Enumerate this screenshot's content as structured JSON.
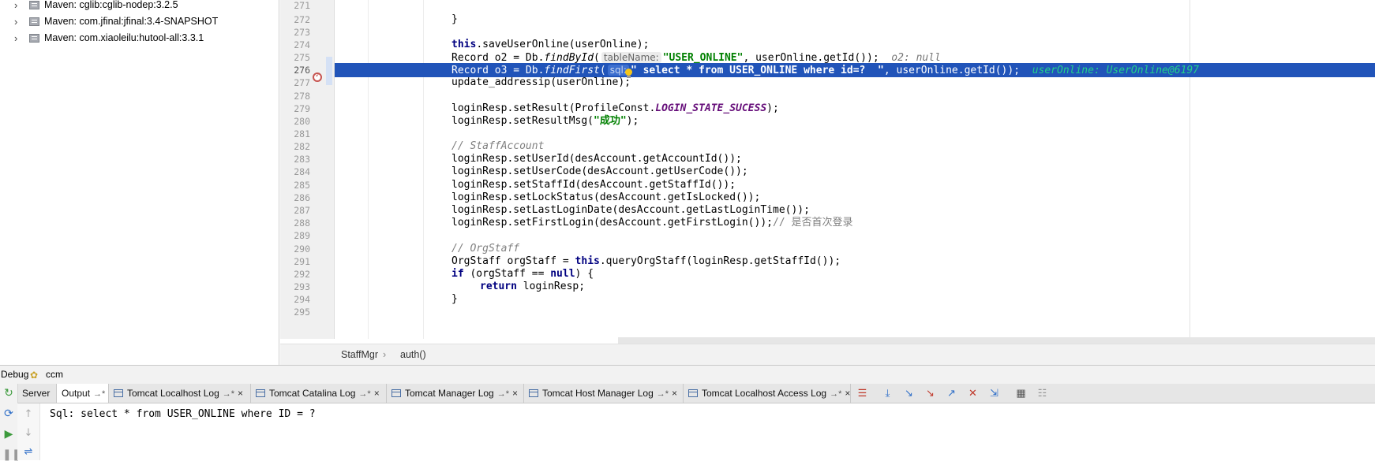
{
  "project_tree": {
    "items": [
      {
        "label": "Maven: cglib:cglib-nodep:3.2.5"
      },
      {
        "label": "Maven: com.jfinal:jfinal:3.4-SNAPSHOT"
      },
      {
        "label": "Maven: com.xiaoleilu:hutool-all:3.3.1"
      }
    ]
  },
  "editor": {
    "line_numbers": [
      "271",
      "272",
      "273",
      "274",
      "275",
      "276",
      "277",
      "278",
      "279",
      "280",
      "281",
      "282",
      "283",
      "284",
      "285",
      "286",
      "287",
      "288",
      "289",
      "290",
      "291",
      "292",
      "293",
      "294",
      "295"
    ],
    "execution_line": "276",
    "code": {
      "l272": "}",
      "l274_kw": "this",
      "l274_rest": ".saveUserOnline(userOnline);",
      "l275_a": "Record o2 = Db.",
      "l275_method": "findById",
      "l275_b": "(",
      "l275_hint": "tableName:",
      "l275_str": "\"USER_ONLINE\"",
      "l275_c": ", userOnline.getId());",
      "l275_debug": "o2: null",
      "l276_a": "Record o3 = Db.",
      "l276_method": "findFirst",
      "l276_b": "(",
      "l276_hint": "sql:",
      "l276_str": "\" select * from USER_ONLINE where id=?  \"",
      "l276_c": ", userOnline.getId());",
      "l276_debug": "userOnline: UserOnline@6197",
      "l277": "update_addressip(userOnline);",
      "l279_a": "loginResp.setResult(ProfileConst.",
      "l279_const": "LOGIN_STATE_SUCESS",
      "l279_b": ");",
      "l280_a": "loginResp.setResultMsg(",
      "l280_str": "\"成功\"",
      "l280_b": ");",
      "l282": "// StaffAccount",
      "l283": "loginResp.setUserId(desAccount.getAccountId());",
      "l284": "loginResp.setUserCode(desAccount.getUserCode());",
      "l285": "loginResp.setStaffId(desAccount.getStaffId());",
      "l286": "loginResp.setLockStatus(desAccount.getIsLocked());",
      "l287": "loginResp.setLastLoginDate(desAccount.getLastLoginTime());",
      "l288_a": "loginResp.setFirstLogin(desAccount.getFirstLogin());",
      "l288_cmt": "// 是否首次登录",
      "l290": "// OrgStaff",
      "l291_a": "OrgStaff orgStaff = ",
      "l291_kw": "this",
      "l291_b": ".queryOrgStaff(loginResp.getStaffId());",
      "l292_kw": "if",
      "l292_a": " (orgStaff == ",
      "l292_kw2": "null",
      "l292_b": ") {",
      "l293_kw": "return",
      "l293_a": " loginResp;",
      "l294": "}"
    },
    "breadcrumb": [
      "StaffMgr",
      "auth()"
    ]
  },
  "debug_panel": {
    "label": "Debug",
    "config_name": "ccm",
    "tabs": [
      {
        "label": "Server"
      },
      {
        "label": "Output"
      },
      {
        "label": "Tomcat Localhost Log"
      },
      {
        "label": "Tomcat Catalina Log"
      },
      {
        "label": "Tomcat Manager Log"
      },
      {
        "label": "Tomcat Host Manager Log"
      },
      {
        "label": "Tomcat Localhost Access Log"
      }
    ],
    "tab_pin": "→*",
    "tab_close": "×",
    "console_output": "Sql: select * from USER_ONLINE where ID = ?"
  },
  "colors": {
    "execution_line": "#2154b9",
    "keyword": "#000080",
    "string": "#008000",
    "breakpoint": "#c75450"
  }
}
